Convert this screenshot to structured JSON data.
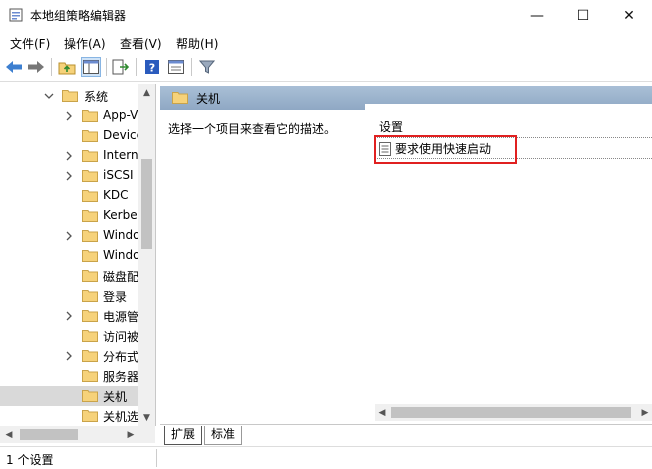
{
  "window": {
    "title": "本地组策略编辑器"
  },
  "menu": [
    "文件(F)",
    "操作(A)",
    "查看(V)",
    "帮助(H)"
  ],
  "tree": [
    {
      "label": "系统",
      "expanded": true,
      "chevron": "down"
    },
    {
      "label": "App-V",
      "chevron": "right"
    },
    {
      "label": "Device",
      "chevron": "none"
    },
    {
      "label": "Intern",
      "chevron": "right"
    },
    {
      "label": "iSCSI",
      "chevron": "right"
    },
    {
      "label": "KDC",
      "chevron": "none"
    },
    {
      "label": "Kerbe",
      "chevron": "none"
    },
    {
      "label": "Windo",
      "chevron": "right"
    },
    {
      "label": "Windo",
      "chevron": "none"
    },
    {
      "label": "磁盘配",
      "chevron": "none"
    },
    {
      "label": "登录",
      "chevron": "none"
    },
    {
      "label": "电源管",
      "chevron": "right"
    },
    {
      "label": "访问被",
      "chevron": "none"
    },
    {
      "label": "分布式",
      "chevron": "right"
    },
    {
      "label": "服务器",
      "chevron": "none"
    },
    {
      "label": "关机",
      "chevron": "none",
      "selected": true
    },
    {
      "label": "关机选",
      "chevron": "none"
    }
  ],
  "right": {
    "header_title": "关机",
    "description": "选择一个项目来查看它的描述。",
    "column_header": "设置",
    "items": [
      "要求使用快速启动"
    ]
  },
  "tabs": [
    "扩展",
    "标准"
  ],
  "status": "1 个设置",
  "colors": {
    "folder": "#f6d27a",
    "header_band": "#9db4cd",
    "highlight": "#e02020"
  }
}
